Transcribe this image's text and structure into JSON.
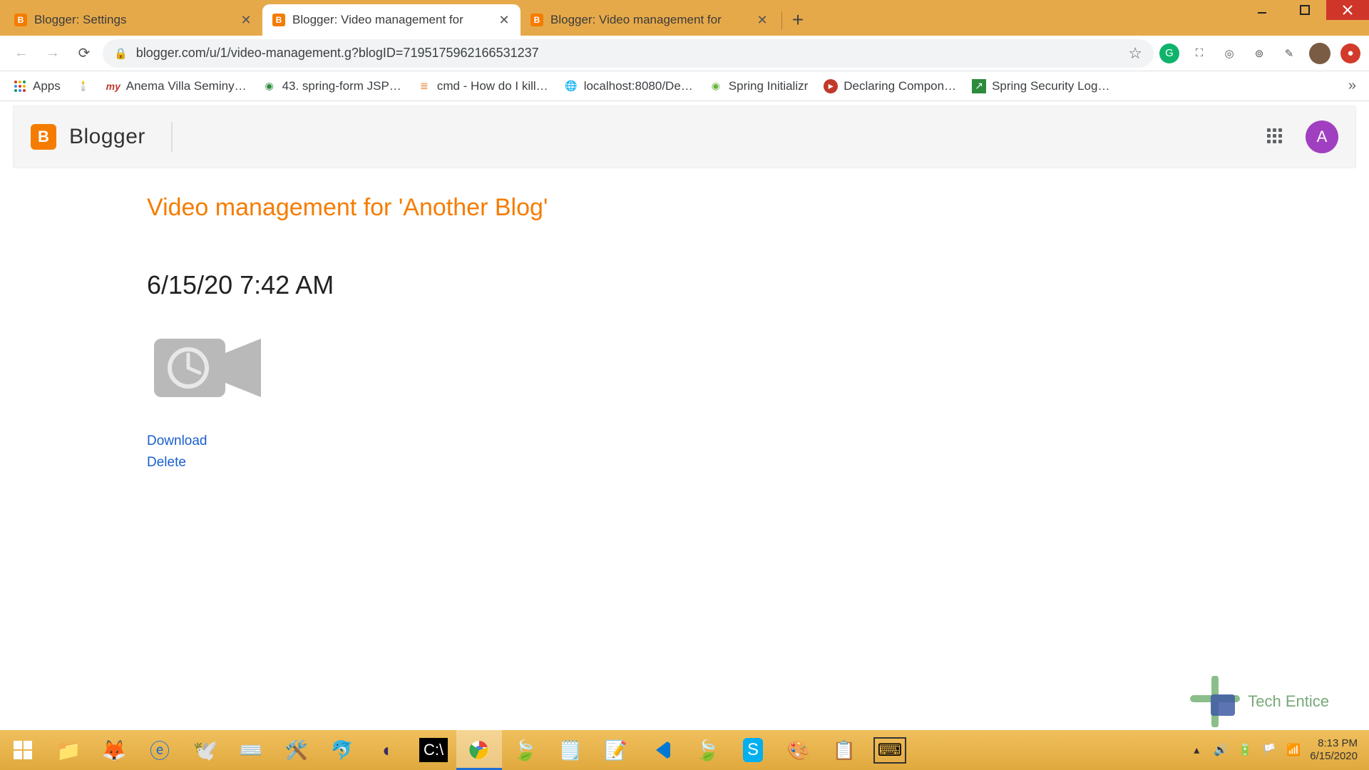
{
  "window": {
    "minimize": "—",
    "close": "✕"
  },
  "tabs": [
    {
      "title": "Blogger: Settings"
    },
    {
      "title": "Blogger: Video management for"
    },
    {
      "title": "Blogger: Video management for"
    }
  ],
  "address": {
    "url": "blogger.com/u/1/video-management.g?blogID=7195175962166531237"
  },
  "bookmarks": {
    "apps": "Apps",
    "items": [
      "Anema Villa Seminy…",
      "43. spring-form JSP…",
      "cmd - How do I kill…",
      "localhost:8080/De…",
      "Spring Initializr",
      "Declaring Compon…",
      "Spring Security Log…"
    ]
  },
  "blogger": {
    "brand": "Blogger",
    "avatar_letter": "A",
    "page_title": "Video management for 'Another Blog'",
    "timestamp": "6/15/20 7:42 AM",
    "download": "Download",
    "delete": "Delete"
  },
  "watermark": {
    "text": "Tech Entice"
  },
  "tray": {
    "time": "8:13 PM",
    "date": "6/15/2020"
  }
}
